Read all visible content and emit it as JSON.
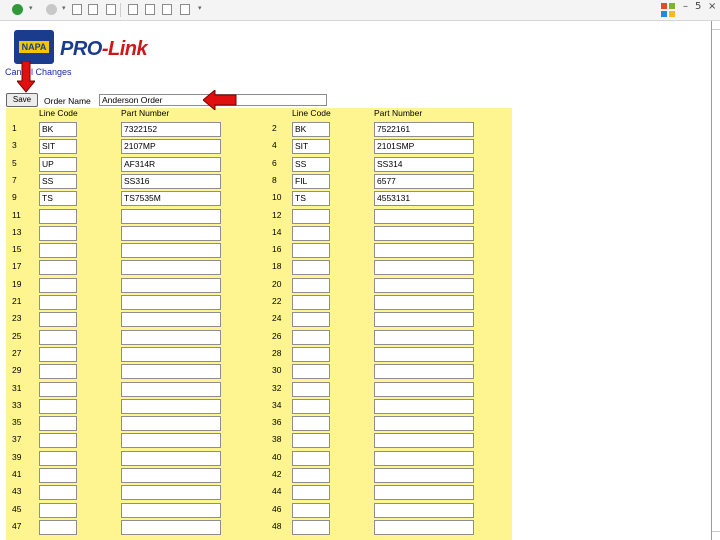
{
  "toolbar": {
    "icons": [
      "back-icon",
      "forward-icon",
      "stop-icon",
      "refresh-icon",
      "home-icon",
      "search-icon",
      "favorites-icon",
      "history-icon",
      "mail-icon"
    ],
    "window_controls": {
      "minimize": "–",
      "restore": "5",
      "close": "×"
    }
  },
  "header": {
    "napa_logo_text": "NAPA",
    "prolink_logo_pro": "PRO",
    "prolink_logo_link": "-Link"
  },
  "controls": {
    "cancel_changes_label": "Cancel Changes",
    "save_label": "Save",
    "order_name_label": "Order Name",
    "order_name_value": "Anderson Order"
  },
  "grid": {
    "header_line_code": "Line Code",
    "header_part_number": "Part Number",
    "rows": [
      {
        "left": {
          "n": "1",
          "code": "BK",
          "part": "7322152"
        },
        "right": {
          "n": "2",
          "code": "BK",
          "part": "7522161"
        }
      },
      {
        "left": {
          "n": "3",
          "code": "SIT",
          "part": "2107MP"
        },
        "right": {
          "n": "4",
          "code": "SIT",
          "part": "2101SMP"
        }
      },
      {
        "left": {
          "n": "5",
          "code": "UP",
          "part": "AF314R"
        },
        "right": {
          "n": "6",
          "code": "SS",
          "part": "SS314"
        }
      },
      {
        "left": {
          "n": "7",
          "code": "SS",
          "part": "SS316"
        },
        "right": {
          "n": "8",
          "code": "FIL",
          "part": "6577"
        }
      },
      {
        "left": {
          "n": "9",
          "code": "TS",
          "part": "TS7535M"
        },
        "right": {
          "n": "10",
          "code": "TS",
          "part": "4553131"
        }
      },
      {
        "left": {
          "n": "11",
          "code": "",
          "part": ""
        },
        "right": {
          "n": "12",
          "code": "",
          "part": ""
        }
      },
      {
        "left": {
          "n": "13",
          "code": "",
          "part": ""
        },
        "right": {
          "n": "14",
          "code": "",
          "part": ""
        }
      },
      {
        "left": {
          "n": "15",
          "code": "",
          "part": ""
        },
        "right": {
          "n": "16",
          "code": "",
          "part": ""
        }
      },
      {
        "left": {
          "n": "17",
          "code": "",
          "part": ""
        },
        "right": {
          "n": "18",
          "code": "",
          "part": ""
        }
      },
      {
        "left": {
          "n": "19",
          "code": "",
          "part": ""
        },
        "right": {
          "n": "20",
          "code": "",
          "part": ""
        }
      },
      {
        "left": {
          "n": "21",
          "code": "",
          "part": ""
        },
        "right": {
          "n": "22",
          "code": "",
          "part": ""
        }
      },
      {
        "left": {
          "n": "23",
          "code": "",
          "part": ""
        },
        "right": {
          "n": "24",
          "code": "",
          "part": ""
        }
      },
      {
        "left": {
          "n": "25",
          "code": "",
          "part": ""
        },
        "right": {
          "n": "26",
          "code": "",
          "part": ""
        }
      },
      {
        "left": {
          "n": "27",
          "code": "",
          "part": ""
        },
        "right": {
          "n": "28",
          "code": "",
          "part": ""
        }
      },
      {
        "left": {
          "n": "29",
          "code": "",
          "part": ""
        },
        "right": {
          "n": "30",
          "code": "",
          "part": ""
        }
      },
      {
        "left": {
          "n": "31",
          "code": "",
          "part": ""
        },
        "right": {
          "n": "32",
          "code": "",
          "part": ""
        }
      },
      {
        "left": {
          "n": "33",
          "code": "",
          "part": ""
        },
        "right": {
          "n": "34",
          "code": "",
          "part": ""
        }
      },
      {
        "left": {
          "n": "35",
          "code": "",
          "part": ""
        },
        "right": {
          "n": "36",
          "code": "",
          "part": ""
        }
      },
      {
        "left": {
          "n": "37",
          "code": "",
          "part": ""
        },
        "right": {
          "n": "38",
          "code": "",
          "part": ""
        }
      },
      {
        "left": {
          "n": "39",
          "code": "",
          "part": ""
        },
        "right": {
          "n": "40",
          "code": "",
          "part": ""
        }
      },
      {
        "left": {
          "n": "41",
          "code": "",
          "part": ""
        },
        "right": {
          "n": "42",
          "code": "",
          "part": ""
        }
      },
      {
        "left": {
          "n": "43",
          "code": "",
          "part": ""
        },
        "right": {
          "n": "44",
          "code": "",
          "part": ""
        }
      },
      {
        "left": {
          "n": "45",
          "code": "",
          "part": ""
        },
        "right": {
          "n": "46",
          "code": "",
          "part": ""
        }
      },
      {
        "left": {
          "n": "47",
          "code": "",
          "part": ""
        },
        "right": {
          "n": "48",
          "code": "",
          "part": ""
        }
      }
    ]
  },
  "colors": {
    "grid_background": "#fef591",
    "annotation_arrow": "#e01010",
    "napa_blue": "#1b3c8c",
    "napa_yellow": "#f2c500"
  }
}
